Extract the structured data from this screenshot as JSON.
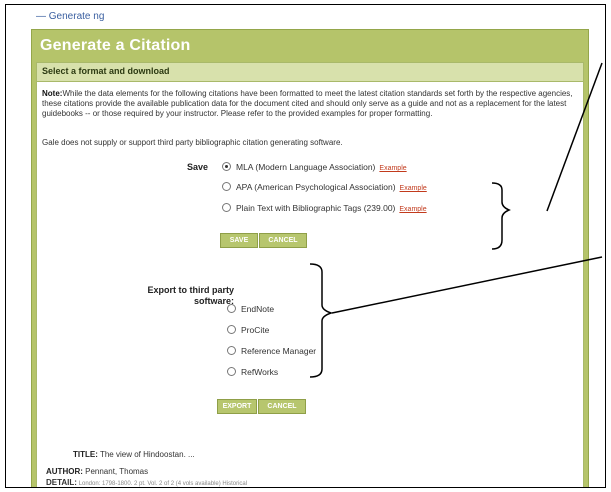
{
  "top_link": "— Generate ng",
  "panel_title": "Generate a Citation",
  "section_title": "Select a format and download",
  "note_label": "Note:",
  "note_text": "While the data elements for the following citations have been formatted to meet the latest citation standards set forth by the respective agencies, these citations provide the available publication data for the document cited and should only serve as a guide and not as a replacement for the latest guidebooks -- or those required by your instructor. Please refer to the provided examples for proper formatting.",
  "gale_note": "Gale does not supply or support third party bibliographic citation generating software.",
  "save_label": "Save",
  "save_options": [
    {
      "label": "MLA (Modern Language Association)",
      "example": "Example",
      "selected": true
    },
    {
      "label": "APA (American Psychological Association)",
      "example": "Example",
      "selected": false
    },
    {
      "label": "Plain Text with Bibliographic Tags (239.00)",
      "example": "Example",
      "selected": false
    }
  ],
  "save_buttons": {
    "save": "SAVE",
    "cancel": "CANCEL"
  },
  "export_label_line1": "Export to third party",
  "export_label_line2": "software:",
  "export_options": [
    {
      "label": "EndNote"
    },
    {
      "label": "ProCite"
    },
    {
      "label": "Reference Manager"
    },
    {
      "label": "RefWorks"
    }
  ],
  "export_buttons": {
    "export": "EXPORT",
    "cancel": "CANCEL"
  },
  "record": {
    "title_label": "TITLE:",
    "title_value": "The view of Hindoostan. ...",
    "author_label": "AUTHOR:",
    "author_value": "Pennant, Thomas",
    "detail_label": "DETAIL:",
    "detail_value": "London: 1798-1800. 2 pt. Vol. 2 of 2 (4 vols available) Historical"
  },
  "colors": {
    "panel": "#b5c46a",
    "section_bar": "#d8e1ac",
    "example_link": "#c23a1c"
  }
}
